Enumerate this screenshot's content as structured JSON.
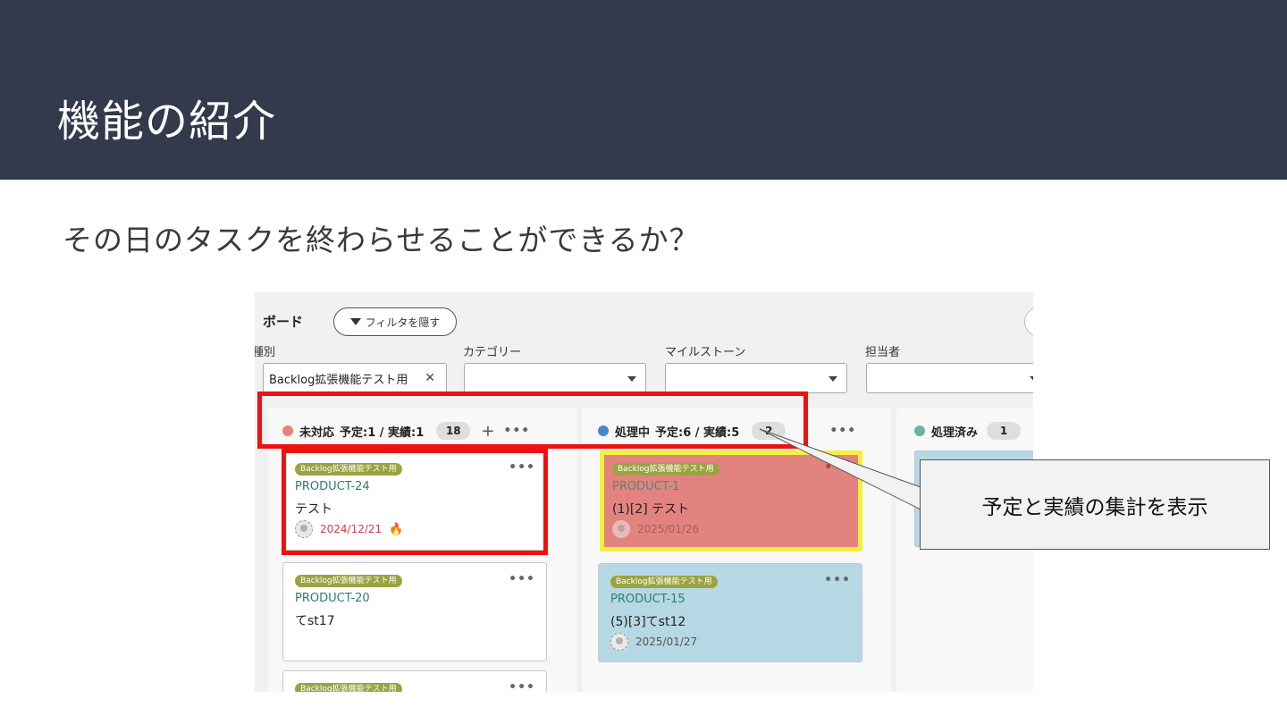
{
  "slide": {
    "title": "機能の紹介",
    "subtitle": "その日のタスクを終わらせることができるか？",
    "callout": "予定と実績の集計を表示"
  },
  "board": {
    "title": "ボード",
    "filter_button": "フィルタを隠す",
    "filters": [
      {
        "label": "種別",
        "value": "Backlog拡張機能テスト用",
        "clear": "✕"
      },
      {
        "label": "カテゴリー",
        "value": ""
      },
      {
        "label": "マイルストーン",
        "value": ""
      },
      {
        "label": "担当者",
        "value": ""
      }
    ],
    "columns": [
      {
        "name": "未対応",
        "stats": "予定:1 / 実績:1",
        "count": "18",
        "add": "+",
        "more": "•••",
        "color": "#e8837a",
        "cards": [
          {
            "tag": "Backlog拡張機能テスト用",
            "key": "PRODUCT-24",
            "summary": "テスト",
            "date": "2024/12/21",
            "more": "•••",
            "date_color": "#d8384a"
          },
          {
            "tag": "Backlog拡張機能テスト用",
            "key": "PRODUCT-20",
            "summary": "てst17",
            "date": "",
            "more": "•••"
          },
          {
            "tag": "Backlog拡張機能テスト用",
            "key": "",
            "summary": "",
            "date": "",
            "more": "•••"
          }
        ]
      },
      {
        "name": "処理中",
        "stats": "予定:6 / 実績:5",
        "count": "2",
        "more": "•••",
        "color": "#4a86d0",
        "cards": [
          {
            "tag": "Backlog拡張機能テスト用",
            "key": "PRODUCT-1",
            "summary": "(1)[2] テスト",
            "date": "2025/01/26",
            "more": "•••",
            "bg": "#e3837f",
            "highlight": "#f6f03c"
          },
          {
            "tag": "Backlog拡張機能テスト用",
            "key": "PRODUCT-15",
            "summary": "(5)[3]てst12",
            "date": "2025/01/27",
            "more": "•••",
            "bg": "#b5d8e4"
          }
        ]
      },
      {
        "name": "処理済み",
        "count": "1",
        "color": "#6bb3a3"
      }
    ]
  },
  "colors": {
    "banner": "#323a4b",
    "highlight": "#ee1111",
    "tag": "#9ba341"
  }
}
